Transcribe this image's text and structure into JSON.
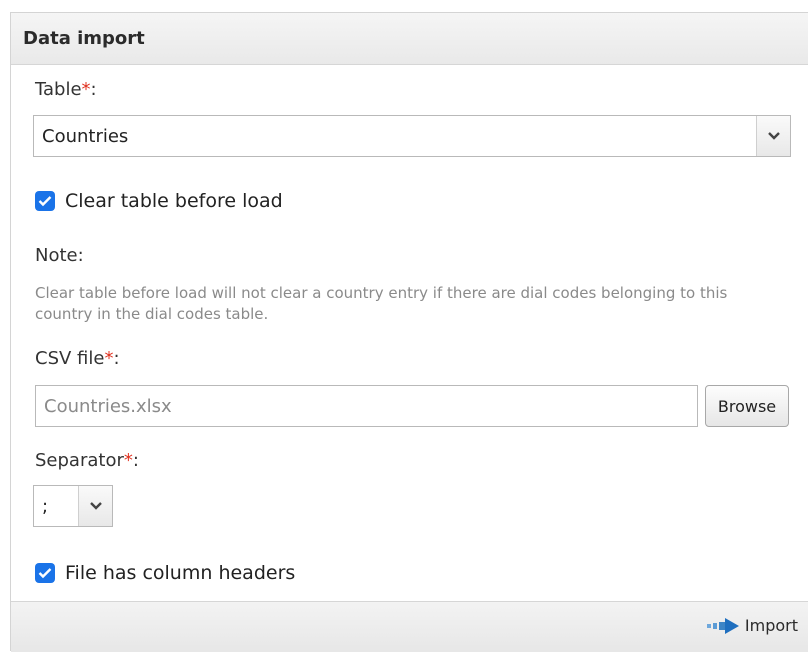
{
  "panel": {
    "title": "Data import"
  },
  "table_field": {
    "label": "Table",
    "required_mark": "*",
    "colon": ":",
    "selected": "Countries"
  },
  "clear_table": {
    "checked": true,
    "label": "Clear table before load"
  },
  "note": {
    "label": "Note:",
    "text": "Clear table before load will not clear a country entry if there are dial codes belonging to this country in the dial codes table."
  },
  "csv_field": {
    "label": "CSV file",
    "required_mark": "*",
    "colon": ":",
    "value": "Countries.xlsx",
    "browse_label": "Browse"
  },
  "separator_field": {
    "label": "Separator",
    "required_mark": "*",
    "colon": ":",
    "selected": ";"
  },
  "headers_checkbox": {
    "checked": true,
    "label": "File has column headers"
  },
  "footer": {
    "import_label": "Import"
  },
  "colors": {
    "accent": "#1a73e8",
    "required": "#e0301e",
    "header_bg": "#eeeeee"
  },
  "icons": {
    "select_arrow": "chevron-down-icon",
    "checkbox": "checkmark-icon",
    "import": "arrow-right-icon"
  }
}
